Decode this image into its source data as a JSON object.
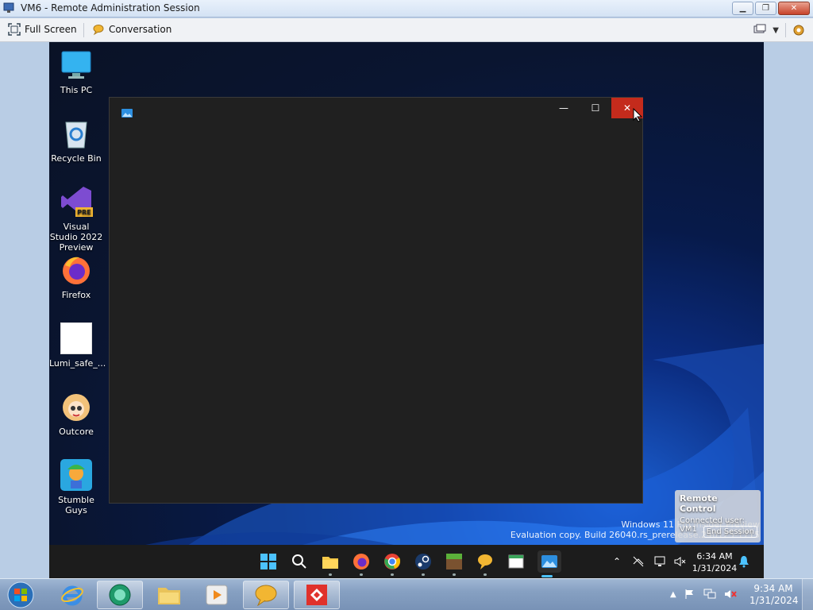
{
  "host": {
    "title": "VM6 - Remote Administration Session",
    "toolbar": {
      "fullscreen_label": "Full Screen",
      "conversation_label": "Conversation"
    }
  },
  "desktop": {
    "icons": [
      {
        "label": "This PC",
        "icon": "monitor-icon"
      },
      {
        "label": "Recycle Bin",
        "icon": "recycle-bin-icon"
      },
      {
        "label": "Visual Studio 2022 Preview",
        "icon": "visual-studio-icon"
      },
      {
        "label": "Firefox",
        "icon": "firefox-icon"
      },
      {
        "label": "Lumi_safe_...",
        "icon": "blank-file-icon"
      },
      {
        "label": "Outcore",
        "icon": "outcore-icon"
      },
      {
        "label": "Stumble Guys",
        "icon": "stumble-guys-icon"
      }
    ],
    "watermark_line1": "Windows 11 Pro Insider Preview",
    "watermark_line2": "Evaluation copy. Build 26040.rs_prerelease.240125-1715"
  },
  "remote_control": {
    "title": "Remote Control",
    "connected": "Connected user: VM1",
    "end_label": "End Session"
  },
  "inner_window": {
    "close": "✕",
    "maximize": "☐",
    "minimize": "—"
  },
  "remote_taskbar": {
    "clock_time": "6:34 AM",
    "clock_date": "1/31/2024",
    "apps": [
      "start-icon",
      "search-icon",
      "file-explorer-icon",
      "firefox-icon",
      "chrome-icon",
      "steam-icon",
      "minecraft-icon",
      "chat-bubble-icon",
      "notepad-icon",
      "photos-icon"
    ]
  },
  "host_taskbar": {
    "clock_time": "9:34 AM",
    "clock_date": "1/31/2024"
  },
  "colors": {
    "close_red": "#c42b1c",
    "accent_blue": "#4cc2ff"
  }
}
